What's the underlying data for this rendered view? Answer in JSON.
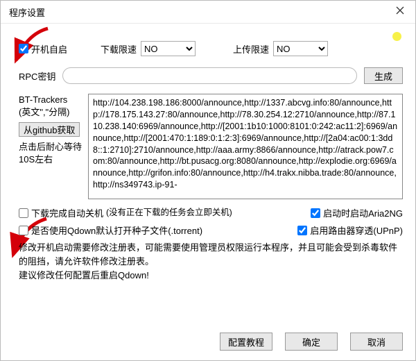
{
  "window": {
    "title": "程序设置"
  },
  "row1": {
    "autostart": {
      "label": "开机自启",
      "checked": true
    },
    "dl_label": "下载限速",
    "dl_value": "NO",
    "ul_label": "上传限速",
    "ul_value": "NO",
    "speed_options": [
      "NO"
    ]
  },
  "rpc": {
    "label": "RPC密钥",
    "value": "",
    "gen_btn": "生成"
  },
  "trackers": {
    "label1": "BT-Trackers",
    "label2": "(英文\",\"分隔)",
    "fetch_btn": "从github获取",
    "note": "点击后耐心等待10S左右",
    "text": "http://104.238.198.186:8000/announce,http://1337.abcvg.info:80/announce,http://178.175.143.27:80/announce,http://78.30.254.12:2710/announce,http://87.110.238.140:6969/announce,http://[2001:1b10:1000:8101:0:242:ac11:2]:6969/announce,http://[2001:470:1:189:0:1:2:3]:6969/announce,http://[2a04:ac00:1:3dd8::1:2710]:2710/announce,http://aaa.army:8866/announce,http://atrack.pow7.com:80/announce,http://bt.pusacg.org:8080/announce,http://explodie.org:6969/announce,http://grifon.info:80/announce,http://h4.trakx.nibba.trade:80/announce,http://ns349743.ip-91-"
  },
  "options": {
    "shutdown": {
      "checked": false,
      "label": "下载完成自动关机",
      "hint": "(没有正在下载的任务会立即关机)"
    },
    "aria2ng": {
      "checked": true,
      "label": "启动时启动Aria2NG"
    },
    "qdown_torrent": {
      "checked": false,
      "label": "是否使用Qdown默认打开种子文件(.torrent)"
    },
    "upnp": {
      "checked": true,
      "label": "启用路由器穿透(UPnP)"
    }
  },
  "paragraph": {
    "line1": "修改开机启动需要修改注册表，可能需要使用管理员权限运行本程序，并且可能会受到杀毒软件的阻挡，请允许软件修改注册表。",
    "line2": "建议修改任何配置后重启Qdown!"
  },
  "footer": {
    "tutorial": "配置教程",
    "ok": "确定",
    "cancel": "取消"
  }
}
